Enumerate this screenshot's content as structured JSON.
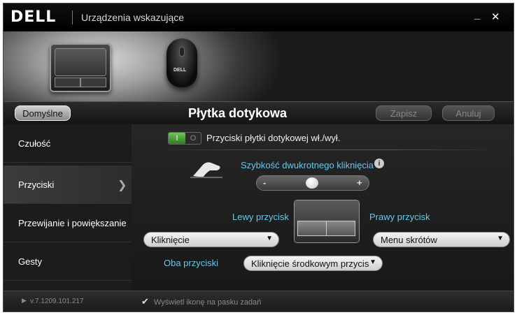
{
  "titlebar": {
    "logo": "DELL",
    "title": "Urządzenia wskazujące",
    "minimize": "_",
    "close": "✕"
  },
  "hero": {
    "mouse_logo": "DELL"
  },
  "header": {
    "default_label": "Domyślne",
    "title": "Płytka dotykowa",
    "save_label": "Zapisz",
    "cancel_label": "Anuluj"
  },
  "sidebar": {
    "items": [
      {
        "label": "Czułość"
      },
      {
        "label": "Przyciski",
        "active": true
      },
      {
        "label": "Przewijanie i powiększanie"
      },
      {
        "label": "Gesty"
      }
    ]
  },
  "main": {
    "toggle": {
      "on": "I",
      "off": "O",
      "state": "on"
    },
    "toggle_label": "Przyciski płytki dotykowej wł./wył.",
    "double_click_speed_label": "Szybkość dwukrotnego kliknięcia",
    "slider": {
      "minus": "-",
      "plus": "+",
      "value": 0.5
    },
    "left_button_label": "Lewy przycisk",
    "right_button_label": "Prawy przycisk",
    "left_select": "Kliknięcie",
    "right_select": "Menu skrótów",
    "both_label": "Oba przyciski",
    "both_select": "Kliknięcie środkowym przycis"
  },
  "footer": {
    "version": "v.7.1209.101.217",
    "show_icon_label": "Wyświetl ikonę na pasku zadań",
    "show_icon_checked": true
  },
  "colors": {
    "accent_link": "#6ec6e8",
    "toggle_on": "#4aa03a",
    "background": "#1e1e1e"
  }
}
